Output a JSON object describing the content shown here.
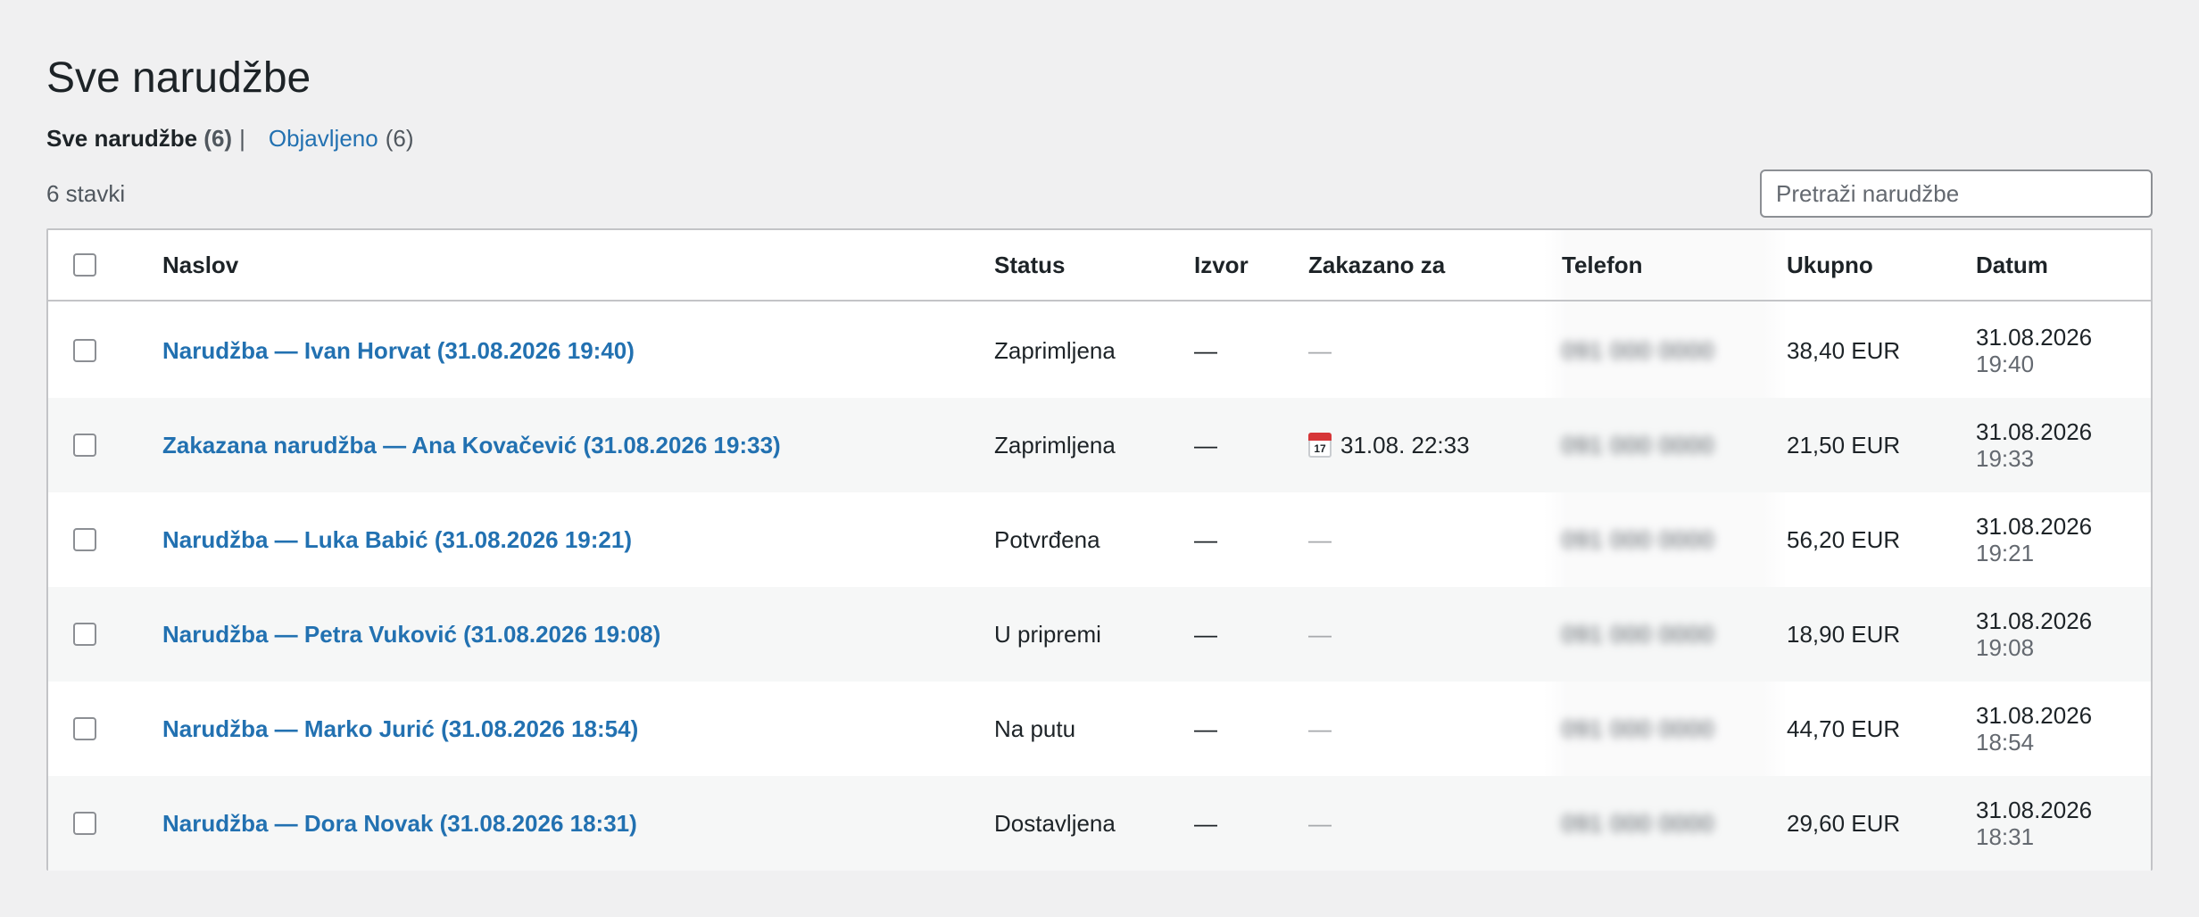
{
  "page": {
    "title": "Sve narudžbe"
  },
  "views": {
    "all_label": "Sve narudžbe",
    "all_count": "(6)",
    "separator": "|",
    "published_label": "Objavljeno",
    "published_count": "(6)"
  },
  "item_count": "6 stavki",
  "search": {
    "placeholder": "Pretraži narudžbe",
    "value": ""
  },
  "columns": {
    "title": "Naslov",
    "status": "Status",
    "source": "Izvor",
    "scheduled": "Zakazano za",
    "phone": "Telefon",
    "total": "Ukupno",
    "date": "Datum"
  },
  "rows": [
    {
      "title": "Narudžba — Ivan Horvat (31.08.2026 19:40)",
      "status": "Zaprimljena",
      "source": "—",
      "scheduled": "—",
      "phone": "091 000 0000",
      "total": "38,40 EUR",
      "date": "31.08.2026",
      "time": "19:40"
    },
    {
      "title": "Zakazana narudžba — Ana Kovačević (31.08.2026 19:33)",
      "status": "Zaprimljena",
      "source": "—",
      "scheduled": "31.08. 22:33",
      "scheduled_icon": "calendar-icon",
      "phone": "091 000 0000",
      "total": "21,50 EUR",
      "date": "31.08.2026",
      "time": "19:33"
    },
    {
      "title": "Narudžba — Luka Babić (31.08.2026 19:21)",
      "status": "Potvrđena",
      "source": "—",
      "scheduled": "—",
      "phone": "091 000 0000",
      "total": "56,20 EUR",
      "date": "31.08.2026",
      "time": "19:21"
    },
    {
      "title": "Narudžba — Petra Vuković (31.08.2026 19:08)",
      "status": "U pripremi",
      "source": "—",
      "scheduled": "—",
      "phone": "091 000 0000",
      "total": "18,90 EUR",
      "date": "31.08.2026",
      "time": "19:08"
    },
    {
      "title": "Narudžba — Marko Jurić (31.08.2026 18:54)",
      "status": "Na putu",
      "source": "—",
      "scheduled": "—",
      "phone": "091 000 0000",
      "total": "44,70 EUR",
      "date": "31.08.2026",
      "time": "18:54"
    },
    {
      "title": "Narudžba — Dora Novak (31.08.2026 18:31)",
      "status": "Dostavljena",
      "source": "—",
      "scheduled": "—",
      "phone": "091 000 0000",
      "total": "29,60 EUR",
      "date": "31.08.2026",
      "time": "18:31"
    }
  ],
  "colors": {
    "link": "#2271b1",
    "text": "#1d2327",
    "background": "#f0f0f1",
    "row_alt": "#f6f7f7",
    "border": "#c3c4c7"
  }
}
